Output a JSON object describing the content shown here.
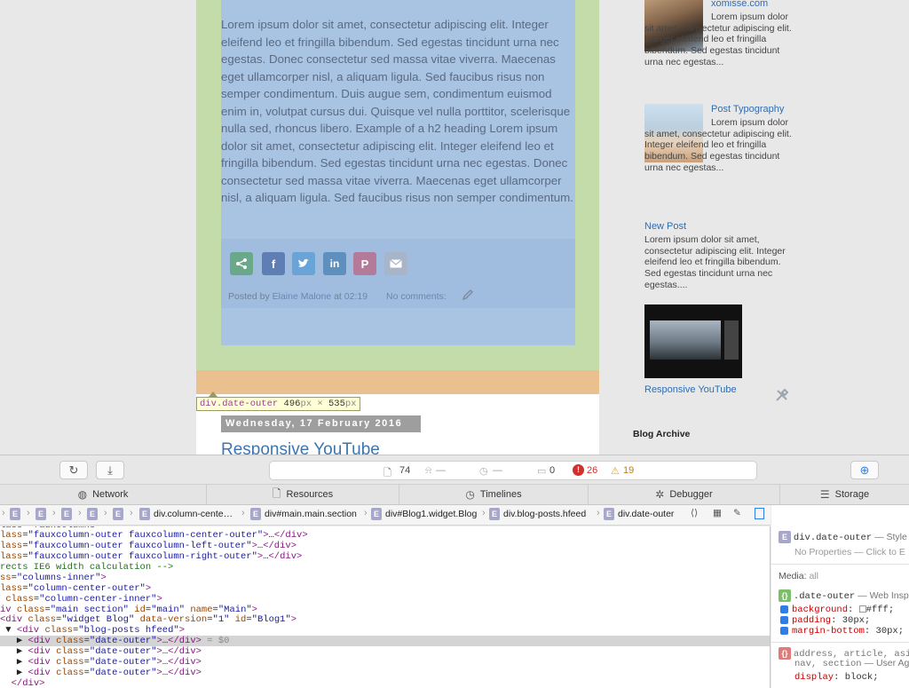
{
  "page": {
    "post_paragraph": "Lorem ipsum dolor sit amet, consectetur adipiscing elit. Integer eleifend leo et fringilla bibendum. Sed egestas tincidunt urna nec egestas. Donec consectetur sed massa vitae viverra. Maecenas eget ullamcorper nisl, a aliquam ligula. Sed faucibus risus non semper condimentum. Duis augue sem, condimentum euismod enim in, volutpat cursus dui. Quisque vel nulla porttitor, scelerisque nulla sed, rhoncus libero. Example of a h2 heading Lorem ipsum dolor sit amet, consectetur adipiscing elit. Integer eleifend leo et fringilla bibendum. Sed egestas tincidunt urna nec egestas. Donec consectetur sed massa vitae viverra. Maecenas eget ullamcorper nisl, a aliquam ligula. Sed faucibus risus non semper condimentum.",
    "footer": {
      "posted_by": "Posted by",
      "author": "Elaine Malone",
      "at": "at",
      "time": "02:19",
      "comments": "No comments:"
    },
    "date_header": "Wednesday, 17 February 2016",
    "next_post_title": "Responsive YouTube"
  },
  "inspector_tooltip": {
    "selector": "div.date-outer",
    "width": "496",
    "height": "535",
    "unit": "px",
    "times": "×"
  },
  "sidebar": {
    "posts": [
      {
        "title": "xomisse.com",
        "text": "Lorem ipsum dolor sit amet, consectetur adipiscing elit. Integer eleifend leo et fringilla bibendum. Sed egestas tincidunt urna nec egestas..."
      },
      {
        "title": "Post Typography",
        "text": "Lorem ipsum dolor sit amet, consectetur adipiscing elit. Integer eleifend leo et fringilla bibendum. Sed egestas tincidunt urna nec egestas..."
      },
      {
        "title": "New Post",
        "text": "Lorem ipsum dolor sit amet, consectetur adipiscing elit. Integer eleifend leo et fringilla bibendum. Sed egestas tincidunt urna nec egestas...."
      },
      {
        "title": "Responsive YouTube"
      }
    ],
    "archive_title": "Blog Archive"
  },
  "toolbar": {
    "resources_count": "74",
    "network_dash": "—",
    "timeline_dash": "—",
    "logs_count": "0",
    "errors_count": "26",
    "warnings_count": "19"
  },
  "tabs": [
    "Network",
    "Resources",
    "Timelines",
    "Debugger",
    "Storage"
  ],
  "breadcrumb": {
    "items": [
      "div.column-cente…",
      "div#main.main.section",
      "div#Blog1.widget.Blog",
      "div.blog-posts.hfeed",
      "div.date-outer"
    ]
  },
  "dom_tree": {
    "selected_suffix": "= $0"
  },
  "styles_panel": {
    "element_rule": "div.date-outer",
    "element_rule_source": "— Style A",
    "no_props": "No Properties — Click to E",
    "media_label": "Media:",
    "media_value": "all",
    "rule_selector": ".date-outer",
    "rule_source": "— Web Insp",
    "declarations": [
      {
        "prop": "background",
        "value": "#fff;"
      },
      {
        "prop": "padding",
        "value": "30px;"
      },
      {
        "prop": "margin-bottom",
        "value": "30px;"
      }
    ],
    "ua_selector_1": "address, article, asid",
    "ua_selector_2": "nav, section",
    "ua_source": "— User Age",
    "ua_prop": "display",
    "ua_value": "block;"
  },
  "colors": {
    "margin_overlay": "#c3dcaa",
    "content_overlay": "#a9c3e3",
    "error_red": "#d0312d",
    "warning_orange": "#e89a16",
    "link_blue": "#2f6db2"
  }
}
